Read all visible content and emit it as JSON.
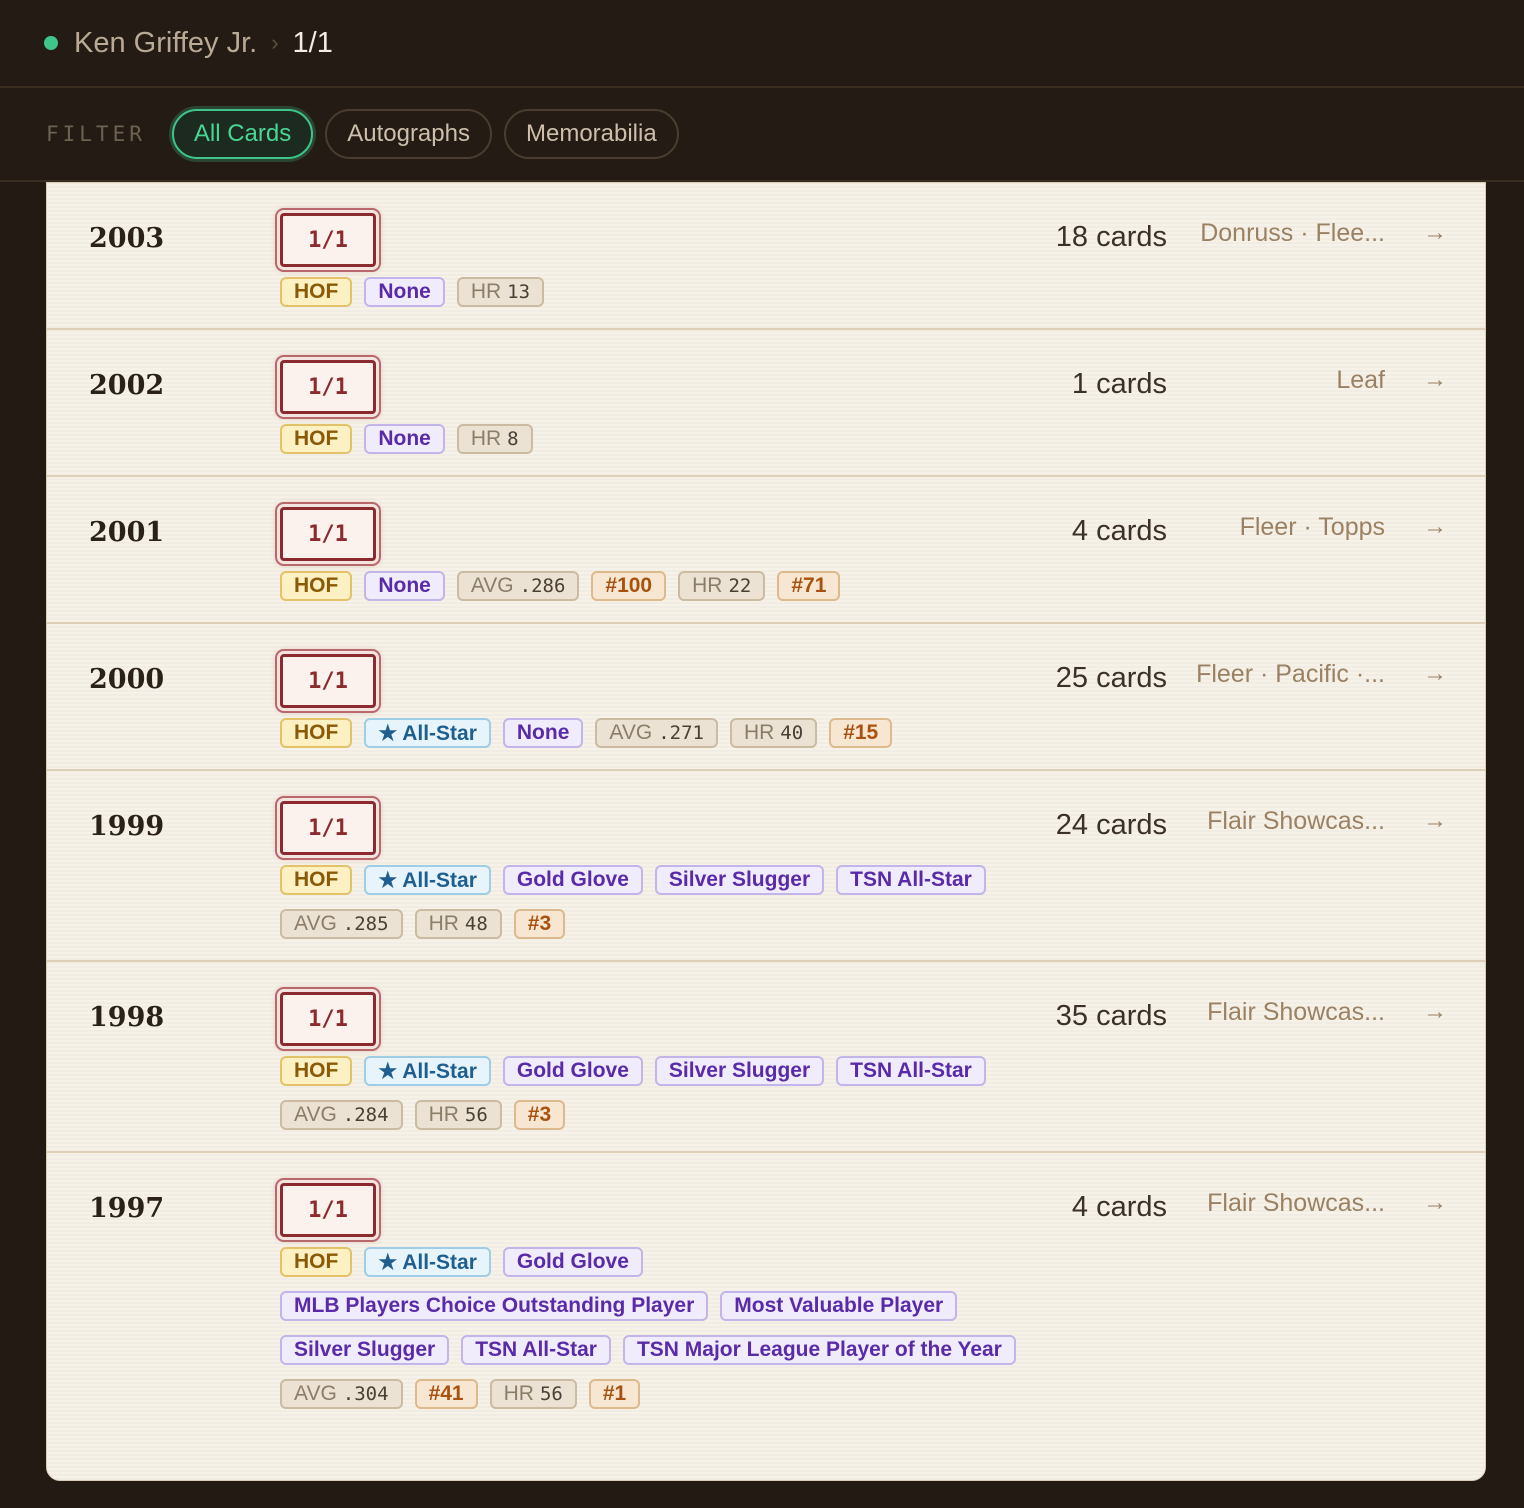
{
  "breadcrumb": {
    "player": "Ken Griffey Jr.",
    "separator": "›",
    "current": "1/1"
  },
  "filter": {
    "label": "FILTER",
    "options": [
      "All Cards",
      "Autographs",
      "Memorabilia"
    ],
    "active": "All Cards"
  },
  "stamp_text": "1/1",
  "arrow": "→",
  "colors": {
    "accent": "#3fc58a",
    "stamp": "#8b2b2f",
    "background": "#231a13"
  },
  "rows": [
    {
      "year": "2003",
      "count": "18 cards",
      "sets": "Donruss · Flee...",
      "height": 147,
      "tags": [
        {
          "type": "hof",
          "text": "HOF"
        },
        {
          "type": "award",
          "text": "None"
        },
        {
          "type": "stat",
          "k": "HR",
          "v": "13"
        }
      ]
    },
    {
      "year": "2002",
      "count": "1 cards",
      "sets": "Leaf",
      "height": 147,
      "tags": [
        {
          "type": "hof",
          "text": "HOF"
        },
        {
          "type": "award",
          "text": "None"
        },
        {
          "type": "stat",
          "k": "HR",
          "v": "8"
        }
      ]
    },
    {
      "year": "2001",
      "count": "4 cards",
      "sets": "Fleer · Topps",
      "height": 147,
      "tags": [
        {
          "type": "hof",
          "text": "HOF"
        },
        {
          "type": "award",
          "text": "None"
        },
        {
          "type": "stat",
          "k": "AVG",
          "v": ".286"
        },
        {
          "type": "rank",
          "text": "#100"
        },
        {
          "type": "stat",
          "k": "HR",
          "v": "22"
        },
        {
          "type": "rank",
          "text": "#71"
        }
      ]
    },
    {
      "year": "2000",
      "count": "25 cards",
      "sets": "Fleer · Pacific ·...",
      "height": 147,
      "tags": [
        {
          "type": "hof",
          "text": "HOF"
        },
        {
          "type": "allstar",
          "text": "★ All-Star"
        },
        {
          "type": "award",
          "text": "None"
        },
        {
          "type": "stat",
          "k": "AVG",
          "v": ".271"
        },
        {
          "type": "stat",
          "k": "HR",
          "v": "40"
        },
        {
          "type": "rank",
          "text": "#15"
        }
      ]
    },
    {
      "year": "1999",
      "count": "24 cards",
      "sets": "Flair Showcas...",
      "height": 191,
      "tags": [
        {
          "type": "hof",
          "text": "HOF"
        },
        {
          "type": "allstar",
          "text": "★ All-Star"
        },
        {
          "type": "award",
          "text": "Gold Glove"
        },
        {
          "type": "award",
          "text": "Silver Slugger"
        },
        {
          "type": "award",
          "text": "TSN All-Star"
        },
        {
          "type": "stat",
          "k": "AVG",
          "v": ".285"
        },
        {
          "type": "stat",
          "k": "HR",
          "v": "48"
        },
        {
          "type": "rank",
          "text": "#3"
        }
      ]
    },
    {
      "year": "1998",
      "count": "35 cards",
      "sets": "Flair Showcas...",
      "height": 191,
      "tags": [
        {
          "type": "hof",
          "text": "HOF"
        },
        {
          "type": "allstar",
          "text": "★ All-Star"
        },
        {
          "type": "award",
          "text": "Gold Glove"
        },
        {
          "type": "award",
          "text": "Silver Slugger"
        },
        {
          "type": "award",
          "text": "TSN All-Star"
        },
        {
          "type": "stat",
          "k": "AVG",
          "v": ".284"
        },
        {
          "type": "stat",
          "k": "HR",
          "v": "56"
        },
        {
          "type": "rank",
          "text": "#3"
        }
      ]
    },
    {
      "year": "1997",
      "count": "4 cards",
      "sets": "Flair Showcas...",
      "height": 330,
      "tags": [
        {
          "type": "hof",
          "text": "HOF"
        },
        {
          "type": "allstar",
          "text": "★ All-Star"
        },
        {
          "type": "award",
          "text": "Gold Glove"
        },
        {
          "type": "award",
          "text": "MLB Players Choice Outstanding Player"
        },
        {
          "type": "award",
          "text": "Most Valuable Player"
        },
        {
          "type": "award",
          "text": "Silver Slugger"
        },
        {
          "type": "award",
          "text": "TSN All-Star"
        },
        {
          "type": "award",
          "text": "TSN Major League Player of the Year"
        },
        {
          "type": "stat",
          "k": "AVG",
          "v": ".304"
        },
        {
          "type": "rank",
          "text": "#41"
        },
        {
          "type": "stat",
          "k": "HR",
          "v": "56"
        },
        {
          "type": "rank",
          "text": "#1"
        }
      ]
    }
  ]
}
